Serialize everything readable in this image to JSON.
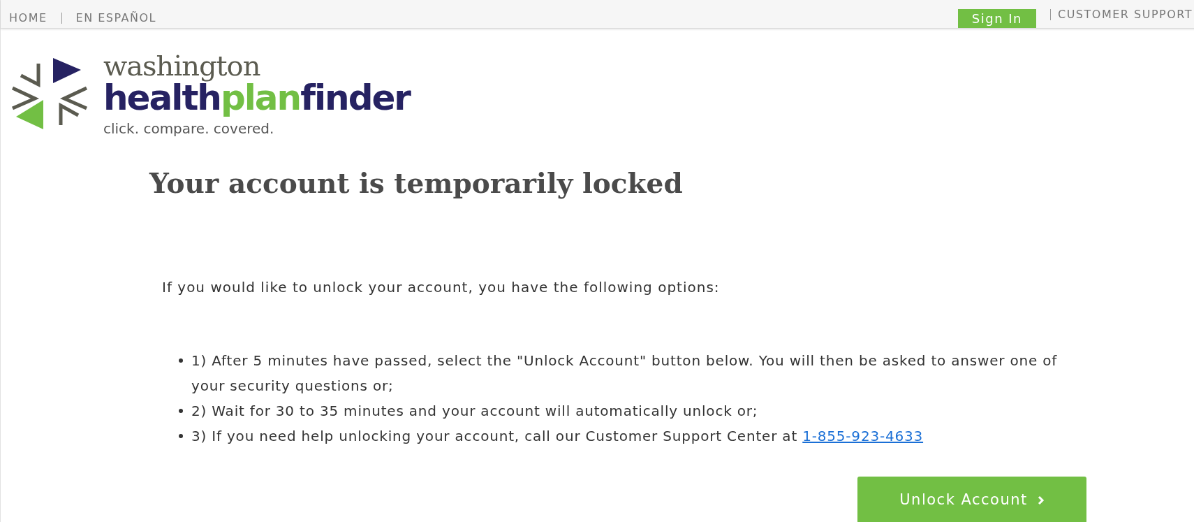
{
  "top_nav": {
    "left_links": [
      "HOME",
      "EN ESPAÑOL"
    ],
    "sign_in": "Sign In",
    "right_link": "CUSTOMER SUPPORT"
  },
  "logo": {
    "state_name": "washington",
    "wordmark_parts": [
      {
        "text": "health",
        "color": "#262262"
      },
      {
        "text": "plan",
        "color": "#72bf44"
      },
      {
        "text": "finder",
        "color": "#262262"
      }
    ],
    "tagline": "click. compare. covered."
  },
  "heading": "Your account is temporarily locked",
  "intro": "If you would like to unlock your account, you have the following options:",
  "options": [
    {
      "text": "1) After 5 minutes have passed, select the \"Unlock Account\" button below. You will then be asked to answer one of your security questions or;"
    },
    {
      "text": "2) Wait for 30 to 35 minutes and your account will automatically unlock or;"
    },
    {
      "text": "3) If you need help unlocking your account, call our Customer Support Center at",
      "link": "1-855-923-4633"
    }
  ],
  "unlock_button": "Unlock Account"
}
